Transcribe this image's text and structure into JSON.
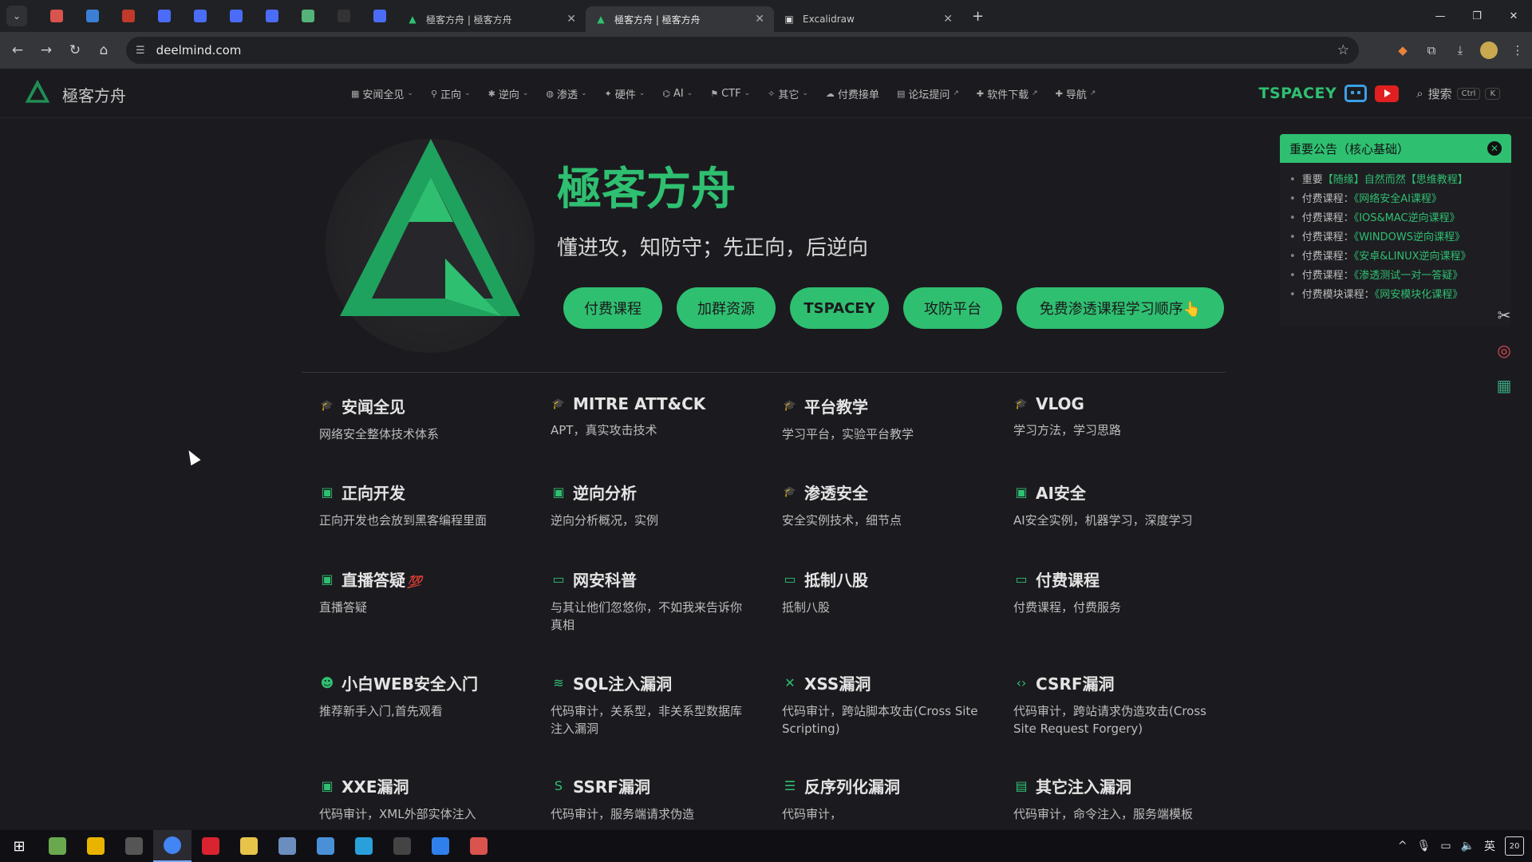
{
  "browser": {
    "tabs": [
      {
        "title": "極客方舟 | 極客方舟",
        "active": false
      },
      {
        "title": "極客方舟 | 極客方舟",
        "active": true
      },
      {
        "title": "Excalidraw",
        "active": false
      }
    ],
    "pinned_colors": [
      "#d9534f",
      "#3b7fd6",
      "#c0392b",
      "#4a6cf7",
      "#4a6cf7",
      "#4a6cf7",
      "#4a6cf7",
      "#55b37a",
      "#333333",
      "#4a6cf7"
    ],
    "url": "deelmind.com"
  },
  "header": {
    "logo_text": "極客方舟",
    "nav": [
      {
        "label": "安闻全见",
        "icon": "grid-icon",
        "caret": true
      },
      {
        "label": "正向",
        "icon": "pin-icon",
        "caret": true
      },
      {
        "label": "逆向",
        "icon": "bug-icon",
        "caret": true
      },
      {
        "label": "渗透",
        "icon": "globe-icon",
        "caret": true
      },
      {
        "label": "硬件",
        "icon": "chip-icon",
        "caret": true
      },
      {
        "label": "AI",
        "icon": "ai-icon",
        "caret": true
      },
      {
        "label": "CTF",
        "icon": "flag-icon",
        "caret": true
      },
      {
        "label": "其它",
        "icon": "bulb-icon",
        "caret": true
      },
      {
        "label": "付费接单",
        "icon": "cloud-icon",
        "caret": false
      },
      {
        "label": "论坛提问",
        "icon": "doc-icon",
        "caret": false,
        "external": true
      },
      {
        "label": "软件下载",
        "icon": "puzzle-icon",
        "caret": false,
        "external": true
      },
      {
        "label": "导航",
        "icon": "puzzle-icon",
        "caret": false,
        "external": true
      }
    ],
    "brand": "TSPACEY",
    "search_label": "搜索",
    "kbd_ctrl": "Ctrl",
    "kbd_k": "K"
  },
  "hero": {
    "title": "極客方舟",
    "subtitle": "懂进攻，知防守；先正向，后逆向",
    "buttons": [
      "付费课程",
      "加群资源",
      "TSPACEY",
      "攻防平台",
      "免费渗透课程学习顺序👆"
    ]
  },
  "features": [
    {
      "title": "安闻全见",
      "desc": "网络安全整体技术体系",
      "icon": "cap-icon"
    },
    {
      "title": "MITRE ATT&CK",
      "desc": "APT，真实攻击技术",
      "icon": "cap-icon"
    },
    {
      "title": "平台教学",
      "desc": "学习平台，实验平台教学",
      "icon": "cap-icon"
    },
    {
      "title": "VLOG",
      "desc": "学习方法，学习思路",
      "icon": "cap-icon"
    },
    {
      "title": "正向开发",
      "desc": "正向开发也会放到黑客编程里面",
      "icon": "code-window-icon"
    },
    {
      "title": "逆向分析",
      "desc": "逆向分析概况，实例",
      "icon": "code-window-icon"
    },
    {
      "title": "渗透安全",
      "desc": "安全实例技术，细节点",
      "icon": "cap-icon"
    },
    {
      "title": "AI安全",
      "desc": "AI安全实例，机器学习，深度学习",
      "icon": "code-window-icon"
    },
    {
      "title": "直播答疑",
      "title_extra": "💯",
      "desc": "直播答疑",
      "icon": "chat-icon"
    },
    {
      "title": "网安科普",
      "desc": "与其让他们忽悠你，不如我来告诉你真相",
      "icon": "screen-icon"
    },
    {
      "title": "抵制八股",
      "desc": "抵制八股",
      "icon": "screen-icon"
    },
    {
      "title": "付费课程",
      "desc": "付费课程，付费服务",
      "icon": "screen-icon"
    },
    {
      "title": "小白WEB安全入门",
      "desc": "推荐新手入门,首先观看",
      "icon": "smile-icon"
    },
    {
      "title": "SQL注入漏洞",
      "desc": "代码审计，关系型，非关系型数据库注入漏洞",
      "icon": "database-icon"
    },
    {
      "title": "XSS漏洞",
      "desc": "代码审计，跨站脚本攻击(Cross Site Scripting)",
      "icon": "x-icon"
    },
    {
      "title": "CSRF漏洞",
      "desc": "代码审计，跨站请求伪造攻击(Cross Site Request Forgery)",
      "icon": "code-icon"
    },
    {
      "title": "XXE漏洞",
      "desc": "代码审计，XML外部实体注入",
      "icon": "svg-icon"
    },
    {
      "title": "SSRF漏洞",
      "desc": "代码审计，服务端请求伪造",
      "icon": "s-icon"
    },
    {
      "title": "反序列化漏洞",
      "desc": "代码审计，",
      "icon": "lines-icon"
    },
    {
      "title": "其它注入漏洞",
      "desc": "代码审计，命令注入，服务端模板",
      "icon": "list-icon"
    }
  ],
  "notice": {
    "title": "重要公告（核心基础）",
    "items": [
      {
        "prefix": "重要",
        "text": "【随缘】自然而然【思维教程】"
      },
      {
        "prefix": "付费课程：",
        "text": "《网络安全AI课程》"
      },
      {
        "prefix": "付费课程：",
        "text": "《IOS&MAC逆向课程》"
      },
      {
        "prefix": "付费课程：",
        "text": "《WINDOWS逆向课程》"
      },
      {
        "prefix": "付费课程：",
        "text": "《安卓&LINUX逆向课程》"
      },
      {
        "prefix": "付费课程：",
        "text": "《渗透测试一对一答疑》"
      },
      {
        "prefix": "付费模块课程：",
        "text": "《网安模块化课程》"
      }
    ]
  },
  "taskbar": {
    "apps": [
      "#6aa84f",
      "#e8b400",
      "#555555",
      "#4285f4",
      "#d9232e",
      "#e8c34a",
      "#6c8ebf",
      "#4a90d9",
      "#2aa0da",
      "#444444",
      "#2f80ed",
      "#d9534f"
    ],
    "tray_lang": "英",
    "notif_count": "20"
  },
  "colors": {
    "accent": "#2fbf71",
    "bg": "#1b1b1f"
  }
}
